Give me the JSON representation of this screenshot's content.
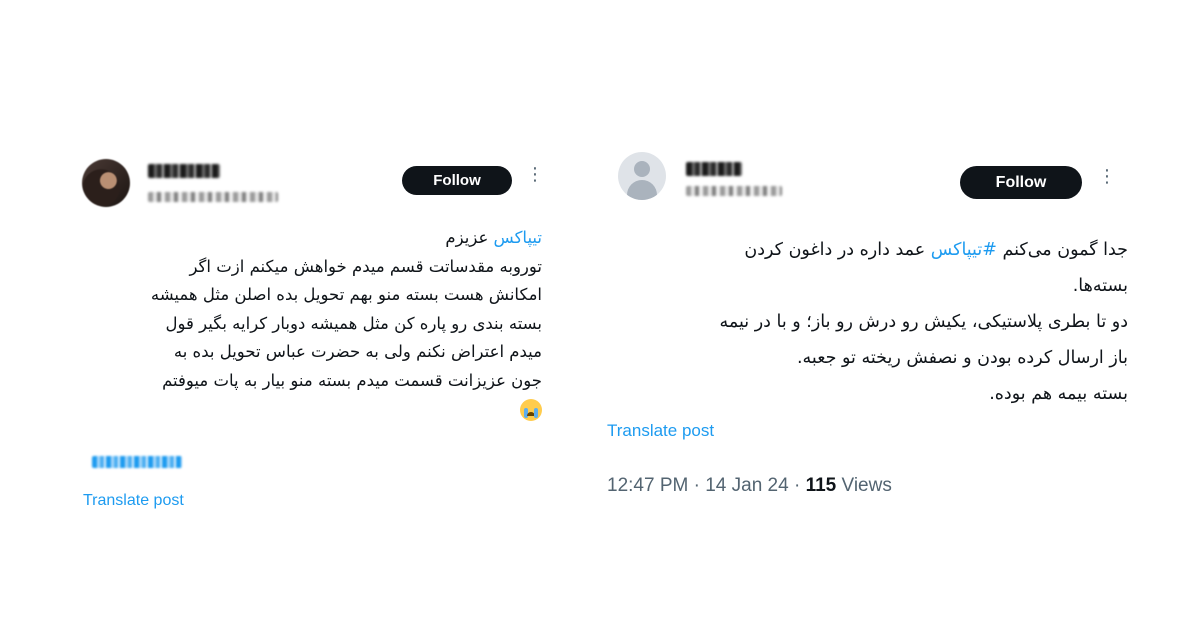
{
  "left_tweet": {
    "follow_label": "Follow",
    "more_icon": "more-vertical-icon",
    "lines": [
      "",
      "توروبه مقدساتت قسم میدم خواهش میکنم ازت اگر",
      "امکانش هست بسته منو بهم تحویل بده اصلن مثل همیشه",
      "بسته بندی رو پاره کن مثل همیشه دوبار کرایه بگیر قول",
      "میدم اعتراض نکنم ولی به حضرت عباس تحویل بده به",
      "جون عزیزانت قسمت میدم بسته منو بیار به پات میوفتم"
    ],
    "first_line_hashtag": "تیپاکس",
    "first_line_suffix": " عزیزم",
    "emoji": "loudly-crying-face-emoji",
    "translate_label": "Translate post"
  },
  "right_tweet": {
    "follow_label": "Follow",
    "more_icon": "more-vertical-icon",
    "line1_prefix": "جدا گمون می‌کنم ",
    "line1_hashtag": "#تیپاکس",
    "line1_suffix": " عمد داره در داغون کردن",
    "lines": [
      "بسته‌ها.",
      "دو تا بطری پلاستیکی، یکیش رو درش رو باز؛ و با در نیمه",
      "باز ارسال کرده بودن و نصفش ریخته تو جعبه.",
      "بسته بیمه هم بوده."
    ],
    "translate_label": "Translate post",
    "timestamp": "12:47 PM · 14 Jan 24 · ",
    "views_count": "115",
    "views_label": " Views"
  },
  "colors": {
    "accent": "#1d9bf0",
    "text": "#0f1419",
    "secondary": "#536471",
    "button_bg": "#0f1419"
  }
}
